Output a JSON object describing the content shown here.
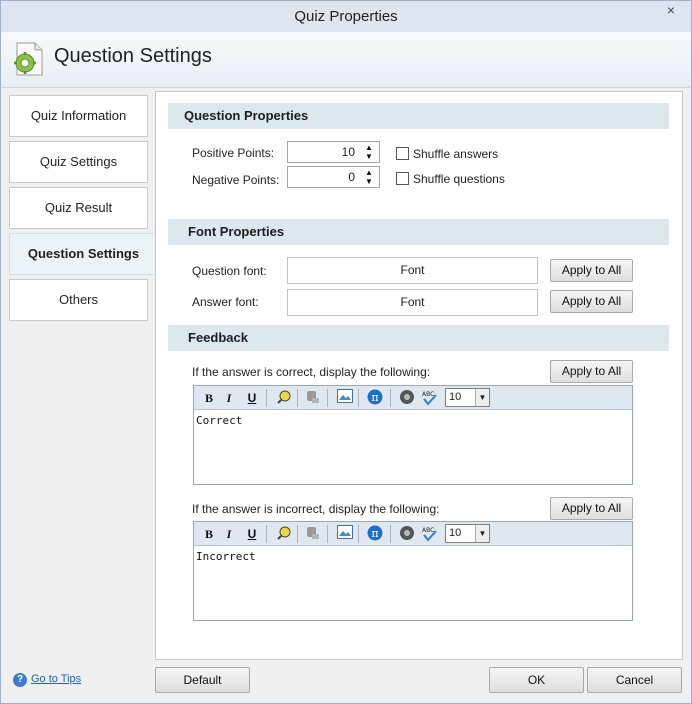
{
  "window": {
    "title": "Quiz Properties",
    "close_glyph": "×"
  },
  "header": {
    "title": "Question Settings",
    "icon": "gear-document-icon"
  },
  "sidebar": {
    "items": [
      {
        "label": "Quiz Information"
      },
      {
        "label": "Quiz Settings"
      },
      {
        "label": "Quiz Result"
      },
      {
        "label": "Question Settings"
      },
      {
        "label": "Others"
      }
    ]
  },
  "question_properties": {
    "heading": "Question Properties",
    "positive_label": "Positive Points:",
    "positive_value": "10",
    "negative_label": "Negative Points:",
    "negative_value": "0",
    "shuffle_answers": "Shuffle answers",
    "shuffle_questions": "Shuffle questions"
  },
  "font_properties": {
    "heading": "Font Properties",
    "question_label": "Question font:",
    "question_value": "Font",
    "answer_label": "Answer font:",
    "answer_value": "Font",
    "apply_label": "Apply to All"
  },
  "feedback": {
    "heading": "Feedback",
    "correct_label": "If the answer is correct,  display the following:",
    "correct_text": "Correct",
    "incorrect_label": "If the answer is incorrect,  display the following:",
    "incorrect_text": "Incorrect",
    "apply_label": "Apply to All",
    "font_size": "10",
    "toolbar": {
      "bold": "B",
      "italic": "I",
      "underline": "U",
      "pi": "π",
      "abc": "ABC"
    }
  },
  "footer": {
    "tips_label": "Go to Tips",
    "default_label": "Default",
    "ok_label": "OK",
    "cancel_label": "Cancel"
  }
}
